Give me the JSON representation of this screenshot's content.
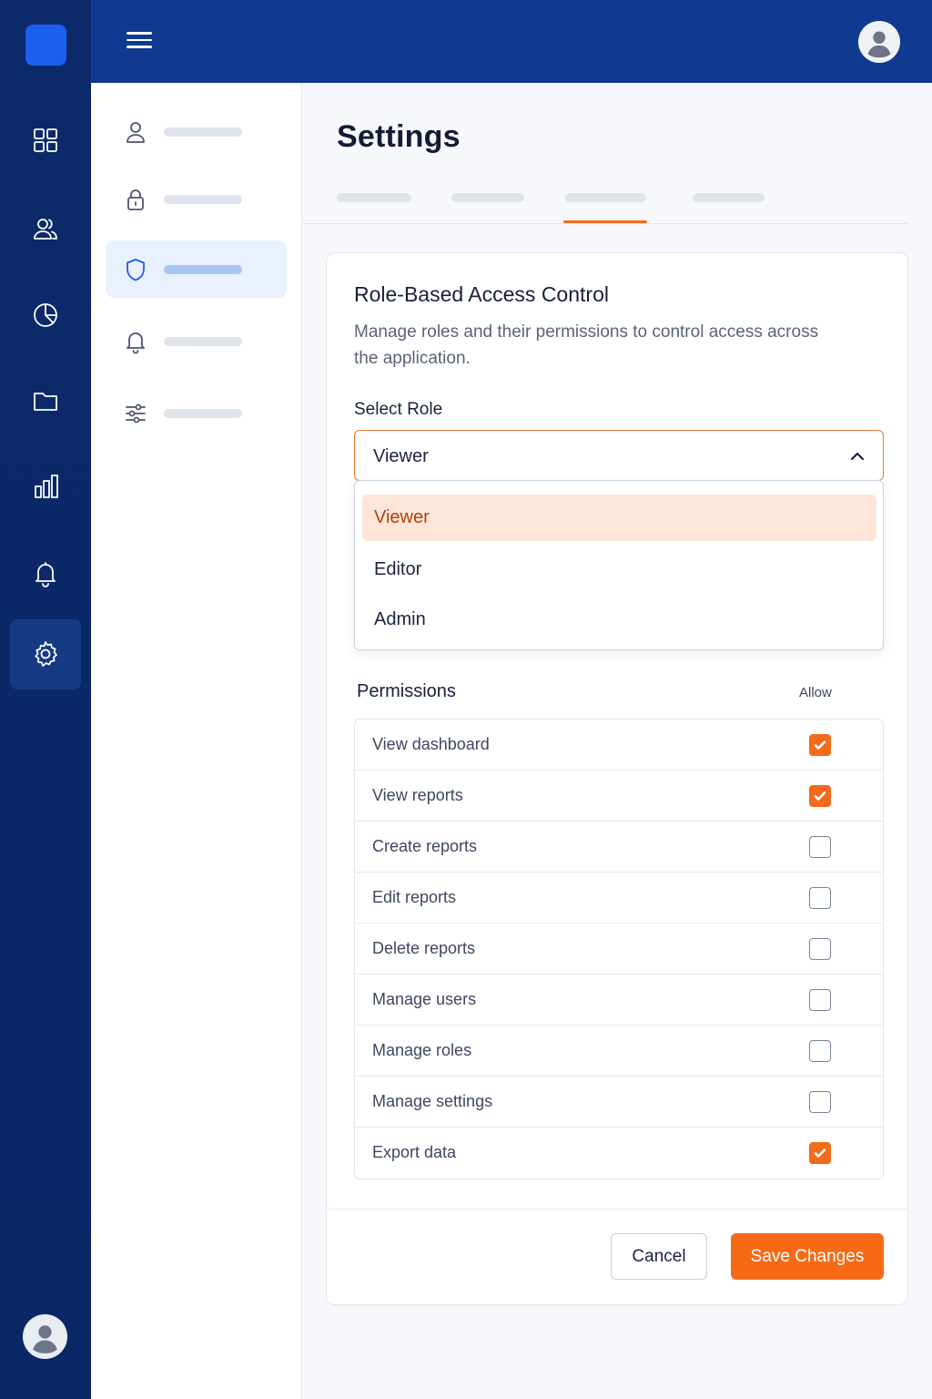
{
  "rail": {
    "icons": [
      "dashboard-icon",
      "users-icon",
      "pie-chart-icon",
      "folder-icon",
      "bar-chart-icon",
      "bell-icon",
      "settings-icon"
    ],
    "active": "settings-icon"
  },
  "topbar": {
    "menu_icon": "hamburger-icon",
    "avatar_icon": "user-avatar-icon"
  },
  "subnav": {
    "items": [
      {
        "icon": "user-icon",
        "active": false
      },
      {
        "icon": "lock-icon",
        "active": false
      },
      {
        "icon": "shield-icon",
        "active": true
      },
      {
        "icon": "bell-icon",
        "active": false
      },
      {
        "icon": "sliders-icon",
        "active": false
      }
    ]
  },
  "main": {
    "title": "Settings",
    "tabs": {
      "count": 4,
      "active_index": 2
    }
  },
  "card": {
    "title": "Role-Based Access Control",
    "description": "Manage roles and their permissions to control access across the application.",
    "select_label": "Select Role",
    "selected_role": "Viewer",
    "options": [
      "Viewer",
      "Editor",
      "Admin"
    ],
    "permissions_label": "Permissions",
    "allow_label": "Allow",
    "permissions": [
      {
        "label": "View dashboard",
        "allowed": true
      },
      {
        "label": "View reports",
        "allowed": true
      },
      {
        "label": "Create reports",
        "allowed": false
      },
      {
        "label": "Edit reports",
        "allowed": false
      },
      {
        "label": "Delete reports",
        "allowed": false
      },
      {
        "label": "Manage users",
        "allowed": false
      },
      {
        "label": "Manage roles",
        "allowed": false
      },
      {
        "label": "Manage settings",
        "allowed": false
      },
      {
        "label": "Export data",
        "allowed": true
      }
    ],
    "cancel_label": "Cancel",
    "save_label": "Save Changes"
  },
  "colors": {
    "accent": "#f26a1b",
    "primary": "#0f3a8f",
    "rail": "#0c2a6b",
    "active_nav": "#1e5ae6"
  }
}
